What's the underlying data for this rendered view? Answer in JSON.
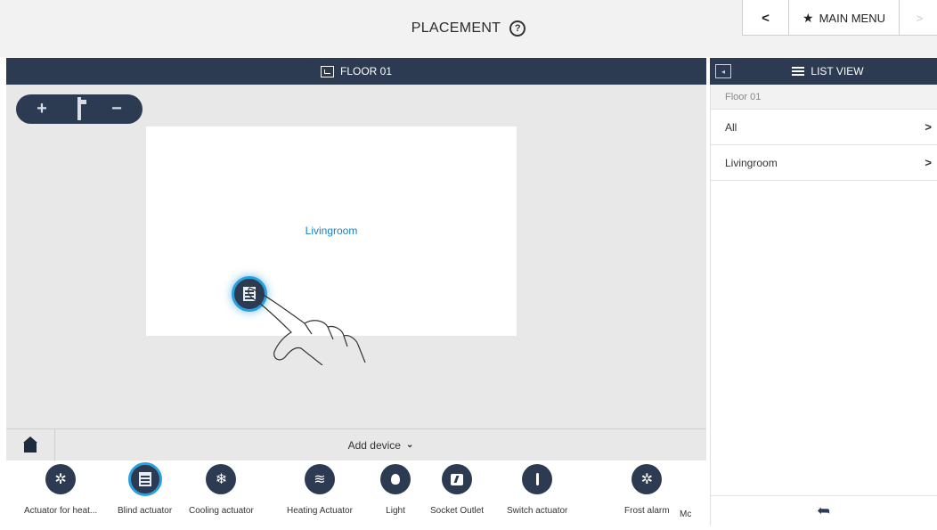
{
  "header": {
    "title": "PLACEMENT",
    "help_icon": "?",
    "back_glyph": "<",
    "forward_glyph": ">",
    "main_menu_label": "MAIN MENU",
    "star_icon": "★"
  },
  "floor_panel": {
    "title": "FLOOR 01",
    "zoom_in": "+",
    "zoom_out": "−",
    "room_label": "Livingroom"
  },
  "bottom_bar": {
    "add_device_label": "Add device",
    "chevron": "⌄"
  },
  "devices": [
    {
      "label": "Actuator for heat...",
      "icon": "actuator-heat-icon",
      "glyph": "✲",
      "selected": false
    },
    {
      "label": "Blind actuator",
      "icon": "blind-icon",
      "glyph": "",
      "selected": true
    },
    {
      "label": "Cooling actuator",
      "icon": "snowflake-icon",
      "glyph": "❄",
      "selected": false
    },
    {
      "label": "Heating Actuator",
      "icon": "heat-waves-icon",
      "glyph": "≋",
      "selected": false
    },
    {
      "label": "Light",
      "icon": "light-bulb-icon",
      "glyph": "",
      "selected": false
    },
    {
      "label": "Socket Outlet",
      "icon": "socket-icon",
      "glyph": "",
      "selected": false
    },
    {
      "label": "Switch actuator",
      "icon": "switch-icon",
      "glyph": "",
      "selected": false
    },
    {
      "label": "Frost alarm",
      "icon": "frost-alarm-icon",
      "glyph": "✲",
      "selected": false
    },
    {
      "label": "Mc",
      "icon": "",
      "glyph": "",
      "selected": false
    }
  ],
  "list_panel": {
    "title": "LIST VIEW",
    "collapse_glyph": "◂",
    "breadcrumb": "Floor 01",
    "items": [
      {
        "label": "All",
        "arrow": ">"
      },
      {
        "label": "Livingroom",
        "arrow": ">"
      }
    ],
    "back_glyph": "➦"
  },
  "colors": {
    "header_navy": "#2c3a52",
    "accent_blue": "#2aa0e0",
    "room_label_blue": "#1a7fc1",
    "canvas_grey": "#e8e8e8"
  }
}
